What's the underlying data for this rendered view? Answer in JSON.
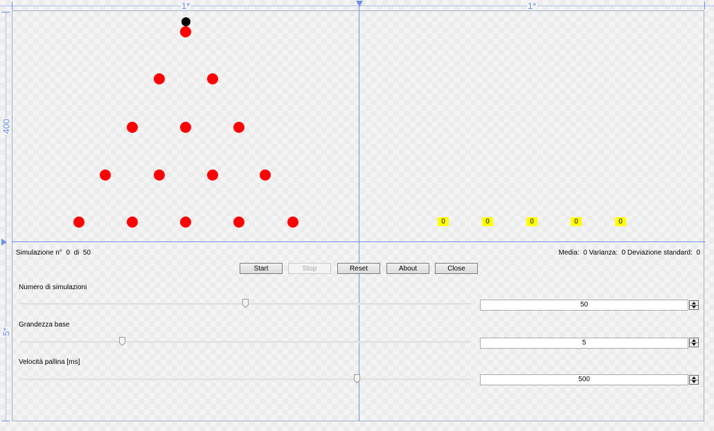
{
  "designer": {
    "column_left": "1*",
    "column_right": "1*",
    "row_top": "400",
    "row_bottom": "5*"
  },
  "board": {
    "peg_color": "#fe0000",
    "ball_color": "#000000",
    "bin_color": "#ffff00",
    "bins": [
      "0",
      "0",
      "0",
      "0",
      "0"
    ]
  },
  "status": {
    "sim_label": "Simulazione n°",
    "sim_current": "0",
    "sim_of": "di",
    "sim_total": "50",
    "media_label": "Media:",
    "media_value": "0",
    "varianza_label": "Varianza:",
    "varianza_value": "0",
    "devstd_label": "Deviazione standard:",
    "devstd_value": "0"
  },
  "buttons": {
    "start": "Start",
    "stop": "Stop",
    "reset": "Reset",
    "about": "About",
    "close": "Close"
  },
  "sliders": {
    "simulations": {
      "label": "Numero di simulazioni",
      "value": "50",
      "fraction": 0.5
    },
    "base": {
      "label": "Grandezza base",
      "value": "5",
      "fraction": 0.222
    },
    "speed": {
      "label": "Velocità pallina [ms]",
      "value": "500",
      "fraction": 0.75
    }
  }
}
